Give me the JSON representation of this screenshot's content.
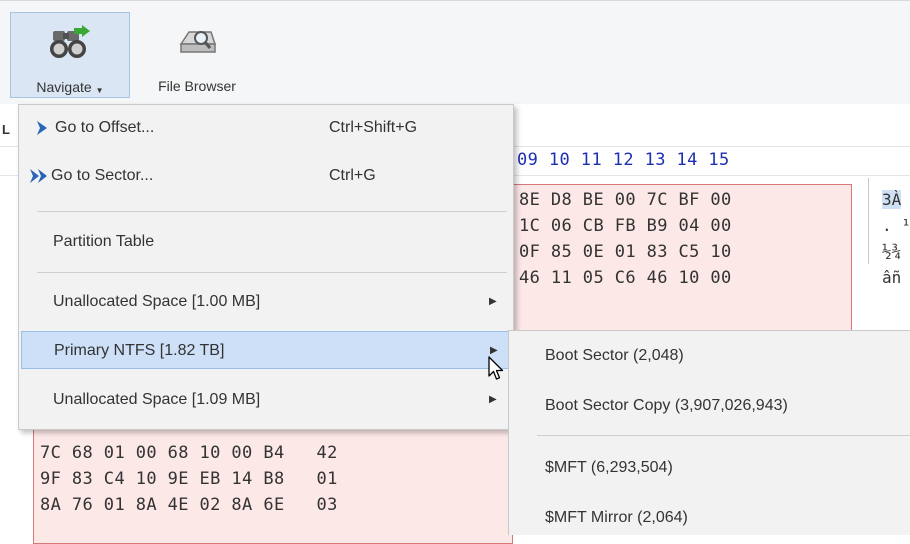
{
  "ribbon": {
    "navigate_label": "Navigate",
    "file_browser_label": "File Browser"
  },
  "tab_partial": "L",
  "hex": {
    "header": "09 10 11 12 13 14 15",
    "top_rows": [
      "8E D8 BE 00 7C BF 00",
      "1C 06 CB FB B9 04 00",
      "0F 85 0E 01 83 C5 10",
      "46 11 05 C6 46 10 00"
    ],
    "bottom_rows": [
      "7C 68 01 00 68 10 00 B4   42",
      "9F 83 C4 10 9E EB 14 B8   01",
      "8A 76 01 8A 4E 02 8A 6E   03"
    ],
    "ascii_rows": [
      "3À",
      ". ¹",
      "½¾",
      "âñ"
    ]
  },
  "menu": {
    "items": [
      {
        "label": "Go to Offset...",
        "shortcut": "Ctrl+Shift+G"
      },
      {
        "label": "Go to Sector...",
        "shortcut": "Ctrl+G"
      },
      {
        "label": "Partition Table"
      },
      {
        "label": "Unallocated Space [1.00 MB]"
      },
      {
        "label": "Primary NTFS [1.82 TB]"
      },
      {
        "label": "Unallocated Space [1.09 MB]"
      }
    ]
  },
  "submenu": {
    "items": [
      "Boot Sector (2,048)",
      "Boot Sector Copy (3,907,026,943)",
      "$MFT (6,293,504)",
      "$MFT Mirror (2,064)"
    ]
  },
  "colors": {
    "highlight": "#cde0f7",
    "hex_header": "#1f2fb0",
    "hex_box": "#fde8e8",
    "arrow_blue": "#2a64b8"
  }
}
